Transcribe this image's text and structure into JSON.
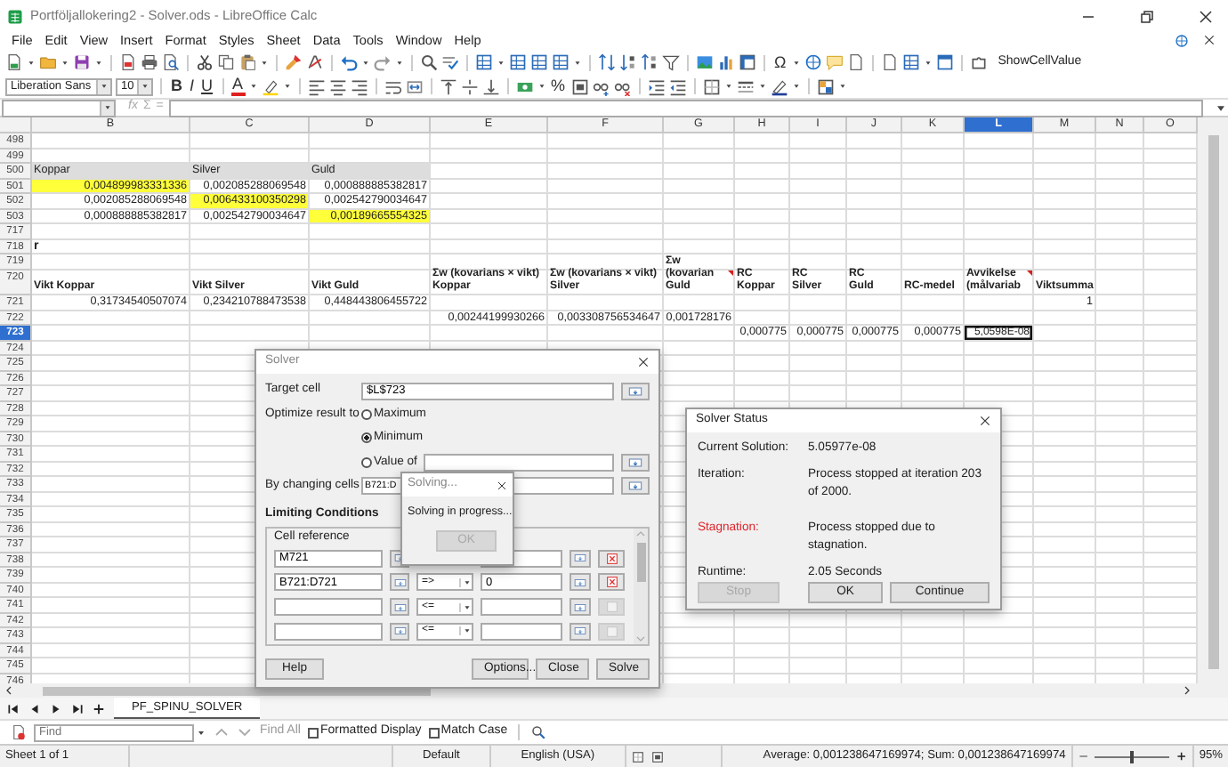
{
  "window": {
    "title": "Portföljallokering2 - Solver.ods - LibreOffice Calc"
  },
  "menu": [
    "File",
    "Edit",
    "View",
    "Insert",
    "Format",
    "Styles",
    "Sheet",
    "Data",
    "Tools",
    "Window",
    "Help"
  ],
  "toolbar": {
    "special_character": "Ω",
    "extension": "ShowCellValue"
  },
  "format_toolbar": {
    "font_name": "Liberation Sans",
    "font_size": "10",
    "bold": "B",
    "italic": "I",
    "underline": "U",
    "font_color": "A",
    "percent": "%"
  },
  "formula_bar": {
    "function_wizard": "fx",
    "sum": "Σ",
    "formula": "="
  },
  "columns": [
    {
      "label": "B",
      "selected": false
    },
    {
      "label": "C",
      "selected": false
    },
    {
      "label": "D",
      "selected": false
    },
    {
      "label": "E",
      "selected": false
    },
    {
      "label": "F",
      "selected": false
    },
    {
      "label": "G",
      "selected": false
    },
    {
      "label": "H",
      "selected": false
    },
    {
      "label": "I",
      "selected": false
    },
    {
      "label": "J",
      "selected": false
    },
    {
      "label": "K",
      "selected": false
    },
    {
      "label": "L",
      "selected": true
    },
    {
      "label": "M",
      "selected": false
    },
    {
      "label": "N",
      "selected": false
    },
    {
      "label": "O",
      "selected": false
    }
  ],
  "rows": [
    {
      "number": "498",
      "selected": false
    },
    {
      "number": "499",
      "selected": false
    },
    {
      "number": "500",
      "selected": false,
      "cells": [
        {
          "kind": "caption",
          "text": "Koppar"
        },
        {
          "kind": "caption",
          "text": "Silver"
        },
        {
          "kind": "caption",
          "text": "Guld"
        }
      ]
    },
    {
      "number": "501",
      "selected": false,
      "cells": [
        {
          "kind": "marked",
          "text": "0,004899983331336"
        },
        {
          "kind": "number",
          "text": "0,002085288069548"
        },
        {
          "kind": "number",
          "text": "0,000888885382817"
        }
      ]
    },
    {
      "number": "502",
      "selected": false,
      "cells": [
        {
          "kind": "number",
          "text": "0,002085288069548"
        },
        {
          "kind": "marked",
          "text": "0,006433100350298"
        },
        {
          "kind": "number",
          "text": "0,002542790034647"
        }
      ]
    },
    {
      "number": "503",
      "selected": false,
      "cells": [
        {
          "kind": "number",
          "text": "0,000888885382817"
        },
        {
          "kind": "number",
          "text": "0,002542790034647"
        },
        {
          "kind": "marked",
          "text": "0,00189665554325"
        }
      ]
    },
    {
      "number": "717",
      "selected": false
    },
    {
      "number": "718",
      "selected": false,
      "cells": [
        {
          "kind": "title",
          "text": "r"
        }
      ]
    },
    {
      "number": "719",
      "selected": false
    },
    {
      "number": "720",
      "selected": false,
      "cells": [
        {
          "kind": "heading",
          "text": "Vikt Koppar"
        },
        {
          "kind": "heading",
          "text": "Vikt Silver"
        },
        {
          "kind": "heading",
          "text": "Vikt Guld"
        },
        {
          "kind": "heading",
          "text": "Σw (kovarians × vikt)\nKoppar"
        },
        {
          "kind": "heading",
          "text": "Σw (kovarians × vikt)\nSilver"
        },
        {
          "kind": "heading",
          "text": "Σw (kovarian\nGuld",
          "comment": true
        },
        {
          "kind": "heading",
          "text": "RC\nKoppar"
        },
        {
          "kind": "heading",
          "text": "RC\nSilver"
        },
        {
          "kind": "heading",
          "text": "RC\nGuld"
        },
        {
          "kind": "heading",
          "text": "RC-medel"
        },
        {
          "kind": "heading",
          "text": "Avvikelse\n(målvariab",
          "comment": true
        },
        {
          "kind": "heading",
          "text": "Viktsumma"
        }
      ]
    },
    {
      "number": "721",
      "selected": false,
      "cells": [
        {
          "kind": "number",
          "text": "0,31734540507074"
        },
        {
          "kind": "number",
          "text": "0,234210788473538"
        },
        {
          "kind": "number",
          "text": "0,448443806455722"
        },
        null,
        null,
        null,
        null,
        null,
        null,
        null,
        null,
        {
          "kind": "number",
          "text": "1"
        }
      ]
    },
    {
      "number": "722",
      "selected": false,
      "cells": [
        null,
        null,
        null,
        {
          "kind": "number",
          "text": "0,00244199930266"
        },
        {
          "kind": "number",
          "text": "0,003308756534647"
        },
        {
          "kind": "number",
          "text": "0,001728176"
        }
      ]
    },
    {
      "number": "723",
      "selected": true,
      "cells": [
        null,
        null,
        null,
        null,
        null,
        null,
        {
          "kind": "number",
          "text": "0,000775"
        },
        {
          "kind": "number",
          "text": "0,000775"
        },
        {
          "kind": "number",
          "text": "0,000775"
        },
        {
          "kind": "number",
          "text": "0,000775"
        },
        {
          "kind": "cursor",
          "text": "5,0598E-08"
        }
      ]
    },
    {
      "number": "724",
      "selected": false
    },
    {
      "number": "725",
      "selected": false
    },
    {
      "number": "726",
      "selected": false
    },
    {
      "number": "727",
      "selected": false
    },
    {
      "number": "728",
      "selected": false
    },
    {
      "number": "729",
      "selected": false
    },
    {
      "number": "730",
      "selected": false
    },
    {
      "number": "731",
      "selected": false
    },
    {
      "number": "732",
      "selected": false
    },
    {
      "number": "733",
      "selected": false
    },
    {
      "number": "734",
      "selected": false
    },
    {
      "number": "735",
      "selected": false
    },
    {
      "number": "736",
      "selected": false
    },
    {
      "number": "737",
      "selected": false
    },
    {
      "number": "738",
      "selected": false
    },
    {
      "number": "739",
      "selected": false
    },
    {
      "number": "740",
      "selected": false
    },
    {
      "number": "741",
      "selected": false
    },
    {
      "number": "742",
      "selected": false
    },
    {
      "number": "743",
      "selected": false
    },
    {
      "number": "744",
      "selected": false
    },
    {
      "number": "745",
      "selected": false
    },
    {
      "number": "746",
      "selected": false
    }
  ],
  "solver": {
    "title": "Solver",
    "target_label": "Target cell",
    "target": "$L$723",
    "optimize_label": "Optimize result to",
    "options": [
      {
        "label": "Maximum",
        "selected": false
      },
      {
        "label": "Minimum",
        "selected": true
      },
      {
        "label": "Value of",
        "selected": false
      }
    ],
    "changing_label": "By changing cells",
    "changing": "B721:D",
    "conditions_label": "Limiting Conditions",
    "conditions_header": "Cell reference",
    "conditions": [
      {
        "cell": "M721",
        "deletable": true
      },
      {
        "cell": "B721:D721",
        "operator": "=>",
        "value": "0",
        "deletable": true
      },
      {
        "operator": "<=",
        "deletable": false
      },
      {
        "operator": "<=",
        "deletable": false
      }
    ],
    "buttons": [
      "Help",
      "Options...",
      "Close",
      "Solve"
    ]
  },
  "progress": {
    "title": "Solving...",
    "message": "Solving in progress...",
    "button": {
      "label": "OK",
      "disabled": true
    }
  },
  "status": {
    "title": "Solver Status",
    "rows": [
      {
        "label": "Current Solution:",
        "value": "5.05977e-08",
        "alert": false
      },
      {
        "label": "Iteration:",
        "value": "Process stopped at iteration 203 of 2000.",
        "alert": false
      },
      {
        "label": "Stagnation:",
        "value": "Process stopped due to stagnation.",
        "alert": true
      },
      {
        "label": "Runtime:",
        "value": "2.05 Seconds",
        "alert": false
      }
    ],
    "buttons": [
      {
        "label": "Stop",
        "disabled": true
      },
      {
        "label": "OK",
        "disabled": false
      },
      {
        "label": "Continue",
        "disabled": false
      }
    ]
  },
  "sheet_tabs": [
    {
      "label": "PF_SPINU_SOLVER",
      "selected": true
    }
  ],
  "find_bar": {
    "placeholder": "Find",
    "find_all": "Find All",
    "options": [
      {
        "label": "Formatted Display",
        "checked": false
      },
      {
        "label": "Match Case",
        "checked": false
      }
    ]
  },
  "status_bar": {
    "sheet": "Sheet 1 of 1",
    "style": "Default",
    "language": "English (USA)",
    "summary": "Average: 0,001238647169974; Sum: 0,001238647169974",
    "zoom": {
      "level": 0.47,
      "label": "95%"
    }
  }
}
